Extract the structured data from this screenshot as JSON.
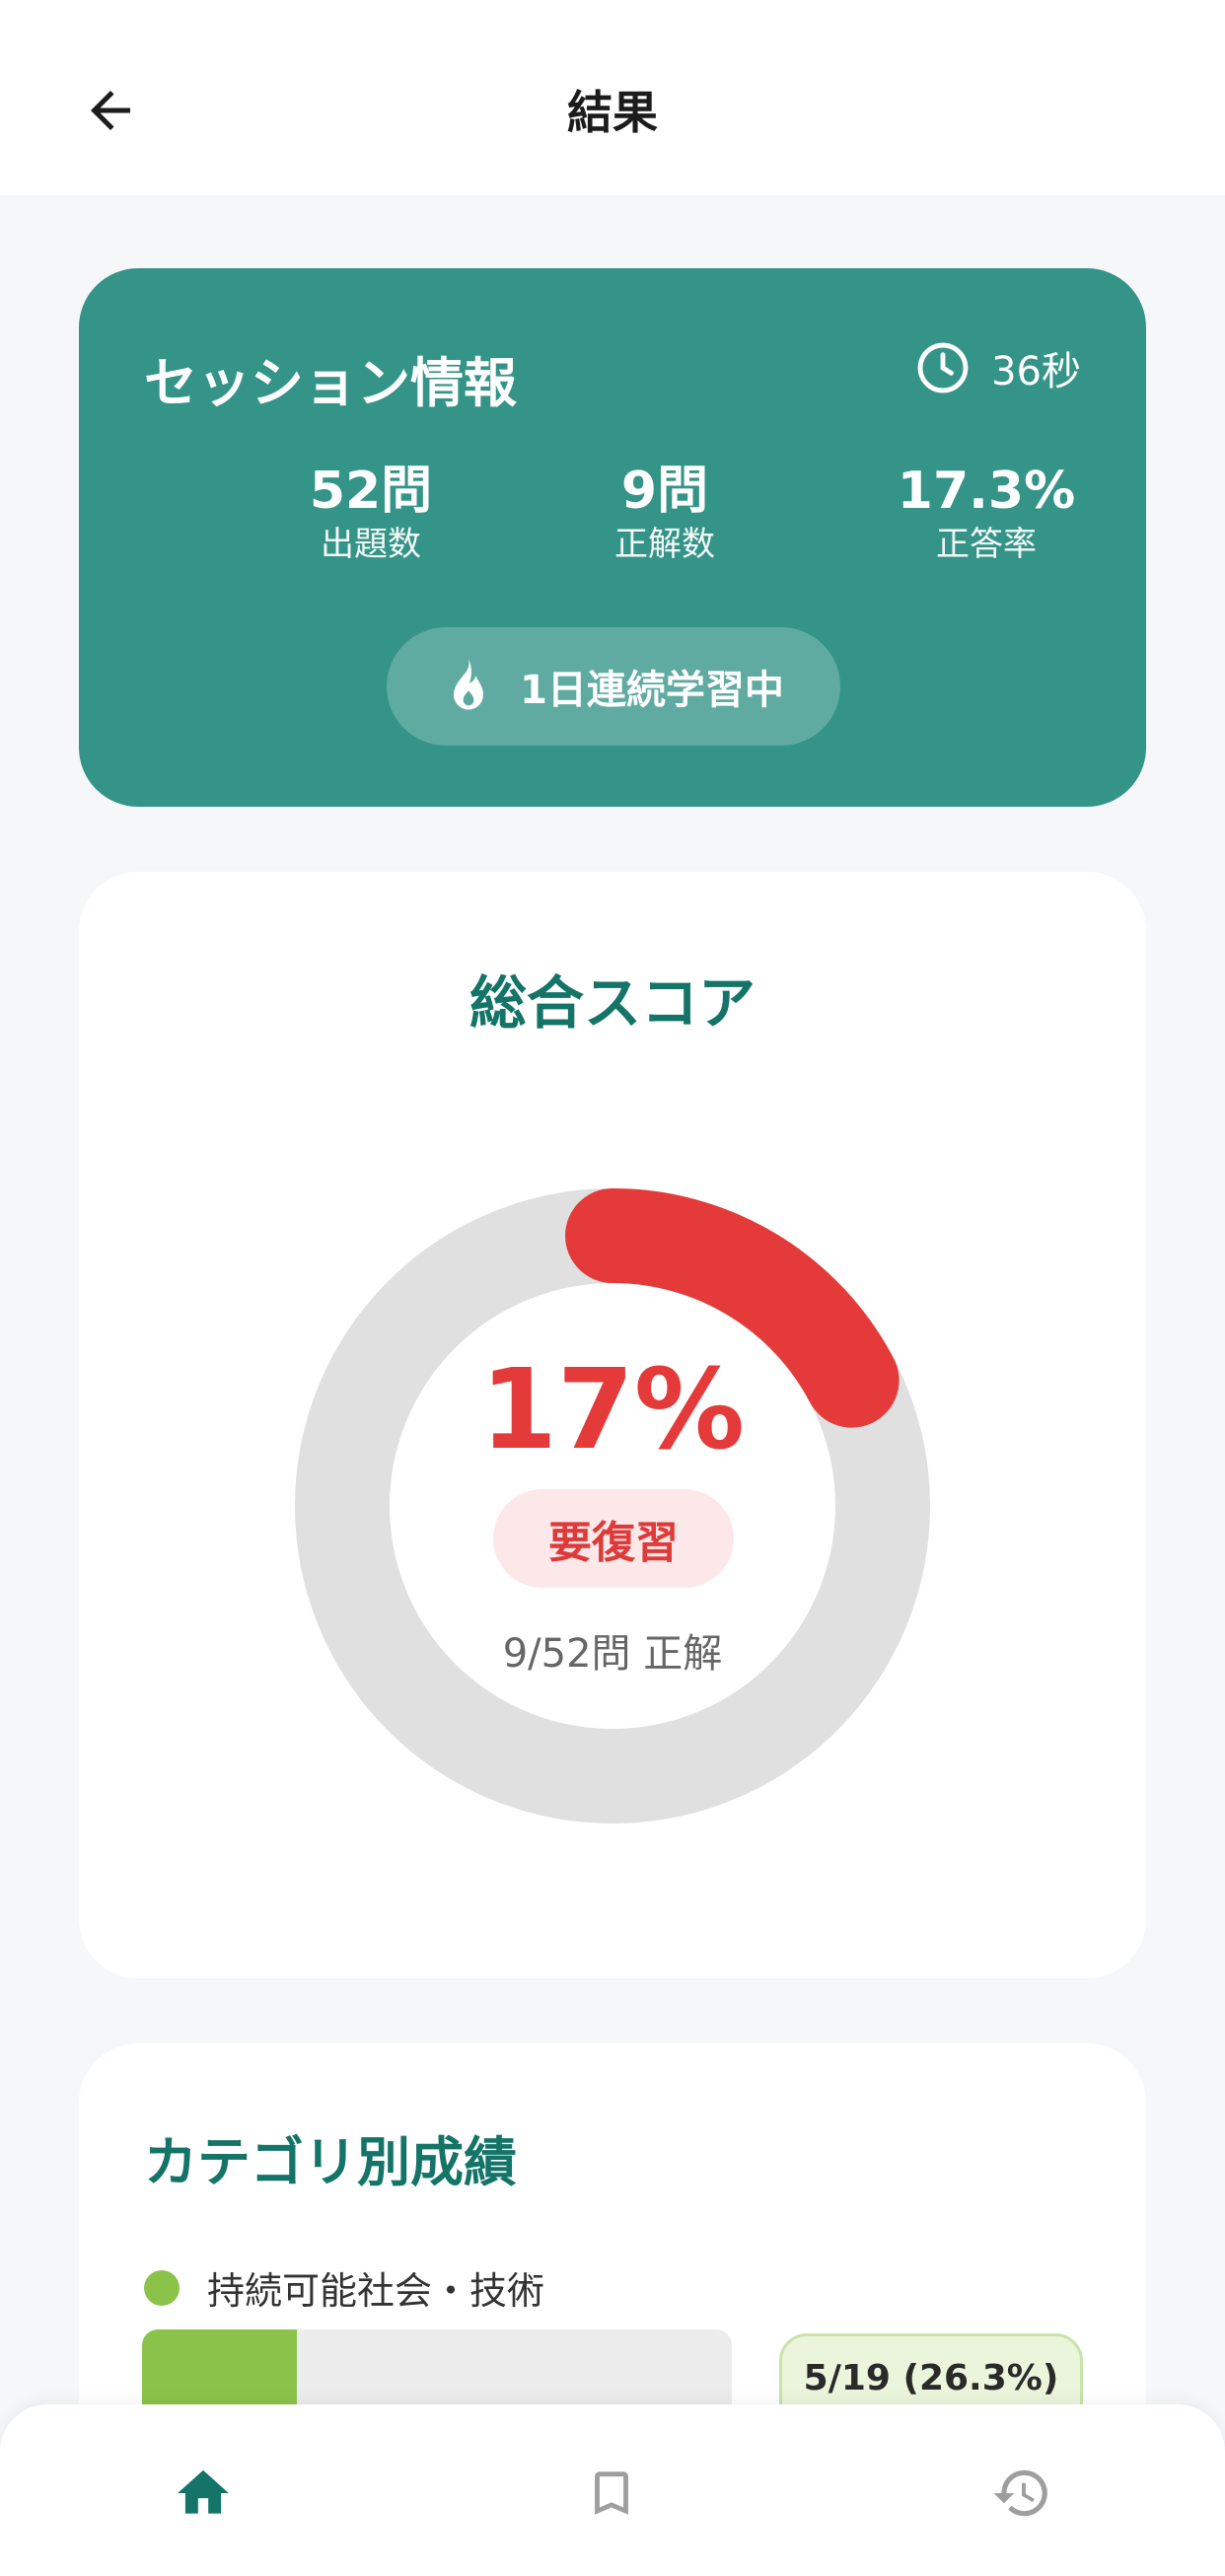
{
  "header": {
    "title": "結果",
    "back_icon": "arrow-left-icon"
  },
  "session": {
    "title": "セッション情報",
    "time": "36秒",
    "time_icon": "clock-icon",
    "stats": [
      {
        "value": "52問",
        "label": "出題数"
      },
      {
        "value": "9問",
        "label": "正解数"
      },
      {
        "value": "17.3%",
        "label": "正答率"
      }
    ],
    "streak": {
      "label": "1日連続学習中",
      "icon": "flame-icon"
    },
    "color": "#349487"
  },
  "score": {
    "title": "総合スコア",
    "percent_label": "17%",
    "progress": 0.173,
    "badge": "要復習",
    "detail": "9/52問 正解",
    "colors": {
      "track": "#e0e0e0",
      "progress": "#e53a3a"
    }
  },
  "categories": {
    "title": "カテゴリ別成績",
    "items": [
      {
        "name": "持続可能社会・技術",
        "score": "5/19 (26.3%)",
        "ratio": 0.263,
        "color": "#8bc34a"
      }
    ]
  },
  "nav": {
    "items": [
      {
        "icon": "home-icon",
        "active": true
      },
      {
        "icon": "bookmark-icon",
        "active": false
      },
      {
        "icon": "history-icon",
        "active": false
      }
    ],
    "active_color": "#137467",
    "inactive_color": "#9e9e9e"
  }
}
